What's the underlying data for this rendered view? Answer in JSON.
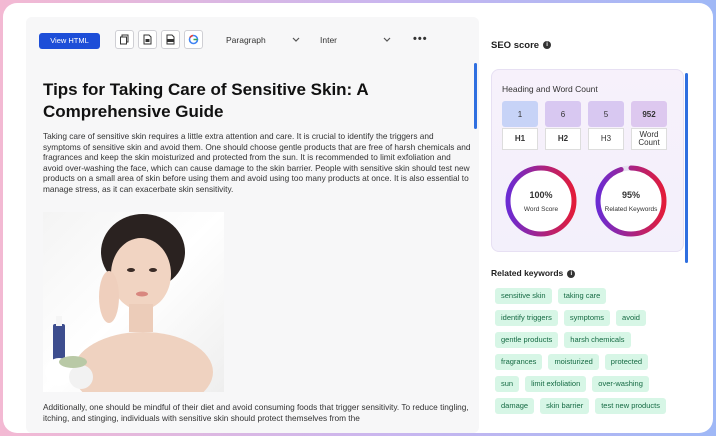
{
  "toolbar": {
    "view_html_label": "View HTML",
    "paragraph_select": "Paragraph",
    "font_select": "Inter",
    "more_label": "•••"
  },
  "icons": [
    "copy-icon",
    "file-icon",
    "pdf-icon",
    "google-icon"
  ],
  "document": {
    "title": "Tips for Taking Care of Sensitive Skin: A Comprehensive Guide",
    "paragraph1": "Taking care of sensitive skin requires a little extra attention and care. It is crucial to identify the triggers and symptoms of sensitive skin and avoid them. One should choose gentle products that are free of harsh chemicals and fragrances and keep the skin moisturized and protected from the sun. It is recommended to limit exfoliation and avoid over-washing the face, which can cause damage to the skin barrier. People with sensitive skin should test new products on a small area of skin before using them and avoid using too many products at once. It is also essential to manage stress, as it can exacerbate skin sensitivity.",
    "paragraph2": "Additionally, one should be mindful of their diet and avoid consuming foods that trigger sensitivity. To reduce tingling, itching, and stinging, individuals with sensitive skin should protect themselves from the"
  },
  "seo": {
    "title": "SEO score",
    "card_title": "Heading and Word Count",
    "counts": [
      {
        "value": "1",
        "label": "H1",
        "color": "#c7d3f7"
      },
      {
        "value": "6",
        "label": "H2",
        "color": "#d8c8f1"
      },
      {
        "value": "5",
        "label": "H3",
        "color": "#d8c8f1"
      },
      {
        "value": "952",
        "label": "Word Count",
        "color": "#ddc8ef"
      }
    ],
    "word_score": {
      "value": "100%",
      "label": "Word Score",
      "fraction": 1.0
    },
    "related_score": {
      "value": "95%",
      "label": "Related Keywords",
      "fraction": 0.95
    }
  },
  "keywords": {
    "title": "Related keywords",
    "rows": [
      [
        "sensitive skin",
        "taking care"
      ],
      [
        "identify triggers",
        "symptoms",
        "avoid"
      ],
      [
        "gentle products",
        "harsh chemicals"
      ],
      [
        "fragrances",
        "moisturized",
        "protected"
      ],
      [
        "sun",
        "limit exfoliation",
        "over-washing"
      ],
      [
        "damage",
        "skin barrier",
        "test new products"
      ]
    ]
  },
  "colors": {
    "accent": "#1d4ed8",
    "chip_bg": "#d7f6e6",
    "chip_text": "#156a43"
  }
}
